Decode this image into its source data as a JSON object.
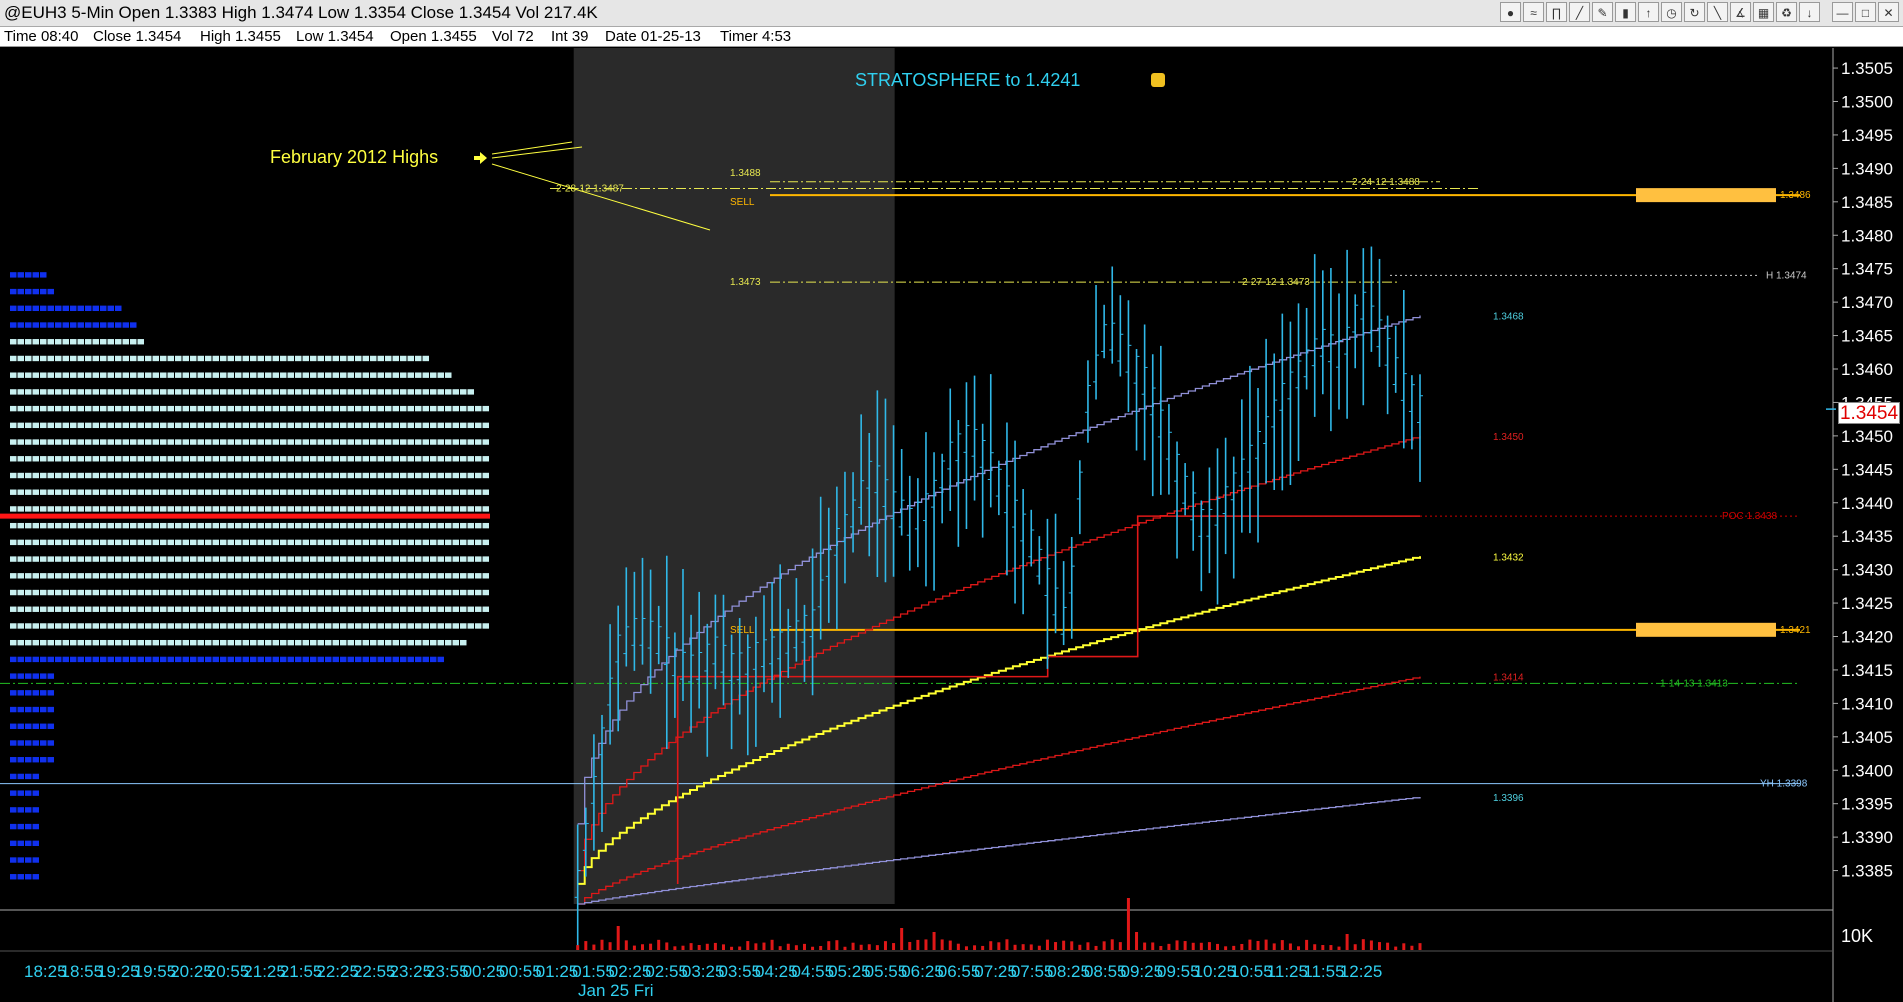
{
  "window": {
    "title": "@EUH3 5-Min Open 1.3383 High 1.3474 Low 1.3354 Close 1.3454 Vol 217.4K",
    "toolbar_icons": [
      "color-icon",
      "fib-icon",
      "pitchfork-icon",
      "trendline-icon",
      "pencil-icon",
      "bar-icon",
      "arrow-up-icon",
      "clock-icon",
      "cycle-icon",
      "draw-icon",
      "fan-icon",
      "grid-icon",
      "trash-icon",
      "down-arrow-icon",
      "minimize-icon",
      "maximize-icon",
      "close-icon"
    ]
  },
  "infobar": {
    "time": "Time 08:40",
    "close": "Close 1.3454",
    "high": "High 1.3455",
    "low": "Low 1.3454",
    "open": "Open 1.3455",
    "vol": "Vol 72",
    "int": "Int 39",
    "date": "Date 01-25-13",
    "timer": "Timer 4:53"
  },
  "chart_data": {
    "type": "candlestick",
    "symbol": "@EUH3",
    "interval": "5-Min",
    "ylim": [
      1.338,
      1.3508
    ],
    "y_ticks": [
      "1.3385",
      "1.3390",
      "1.3395",
      "1.3400",
      "1.3405",
      "1.3410",
      "1.3415",
      "1.3420",
      "1.3425",
      "1.3430",
      "1.3435",
      "1.3440",
      "1.3445",
      "1.3450",
      "1.3455",
      "1.3460",
      "1.3465",
      "1.3470",
      "1.3475",
      "1.3480",
      "1.3485",
      "1.3490",
      "1.3495",
      "1.3500",
      "1.3505"
    ],
    "x_ticks": [
      "18:25",
      "18:55",
      "19:25",
      "19:55",
      "20:25",
      "20:55",
      "21:25",
      "21:55",
      "22:25",
      "22:55",
      "23:25",
      "23:55",
      "00:25",
      "00:55",
      "01:25",
      "01:55",
      "02:25",
      "02:55",
      "03:25",
      "03:55",
      "04:25",
      "04:55",
      "05:25",
      "05:55",
      "06:25",
      "06:55",
      "07:25",
      "07:55",
      "08:25",
      "08:55",
      "09:25",
      "09:55",
      "10:25",
      "10:55",
      "11:25",
      "11:55",
      "12:25"
    ],
    "date_label": "Jan 25 Fri",
    "volume_label": "10K",
    "last_price": "1.3454",
    "headline": "STRATOSPHERE  to  1.4241",
    "annotation": "February 2012 Highs",
    "levels": [
      {
        "price": 1.3488,
        "label_left": "1.3488",
        "label_right": "2-24-12  1.3488",
        "style": "dashdot",
        "color": "#e8e850"
      },
      {
        "price": 1.3487,
        "label_left": "2-28-12  1.3487",
        "style": "dashdot",
        "color": "#e8e850"
      },
      {
        "price": 1.3486,
        "label_left": "SELL",
        "label_right": "1.3486",
        "style": "solid",
        "color": "#ffb700",
        "zone": true
      },
      {
        "price": 1.3474,
        "label_right": "H  1.3474",
        "style": "dotted",
        "color": "#cccccc"
      },
      {
        "price": 1.3473,
        "label_left": "1.3473",
        "label_mid": "2-27-12  1.3473",
        "style": "dashdot",
        "color": "#e8e850"
      },
      {
        "price": 1.3438,
        "label_right": "POC  1.3438",
        "style": "dotted",
        "color": "#d00000"
      },
      {
        "price": 1.3421,
        "label_left": "SELL",
        "label_right": "1.3421",
        "style": "solid",
        "color": "#ffb700",
        "zone": true
      },
      {
        "price": 1.3413,
        "label_right": "1-14-13  1.3413",
        "style": "dashdot",
        "color": "#22c022"
      },
      {
        "price": 1.3398,
        "label_right": "YH  1.3398",
        "style": "solid",
        "color": "#8cc8ff"
      }
    ],
    "band_labels": [
      {
        "text": "1.3468",
        "price": 1.3468,
        "color": "#4fd0e0"
      },
      {
        "text": "1.3450",
        "price": 1.345,
        "color": "#e02020"
      },
      {
        "text": "1.3432",
        "price": 1.3432,
        "color": "#ffff40"
      },
      {
        "text": "1.3414",
        "price": 1.3414,
        "color": "#e02020"
      },
      {
        "text": "1.3396",
        "price": 1.3396,
        "color": "#4fd0e0"
      }
    ],
    "session_shade": {
      "from": "01:25",
      "to": "05:55"
    },
    "highlight_level": 1.3438
  }
}
